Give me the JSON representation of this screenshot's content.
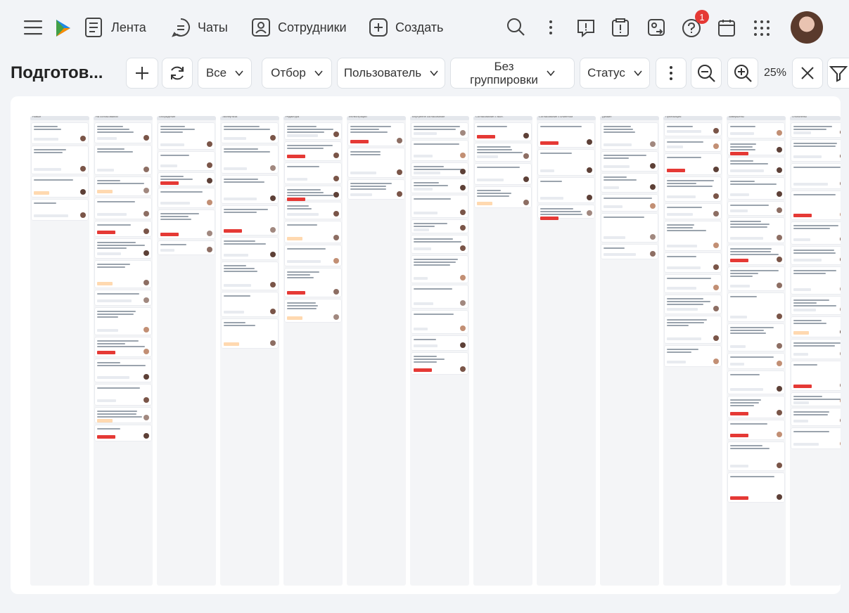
{
  "topbar": {
    "feed_label": "Лента",
    "chats_label": "Чаты",
    "employees_label": "Сотрудники",
    "create_label": "Создать",
    "notification_count": "1"
  },
  "toolbar": {
    "title": "Подготов...",
    "filter_all": "Все",
    "filter_selection": "Отбор",
    "filter_user": "Пользователь",
    "grouping_line1": "Без",
    "grouping_line2": "группировки",
    "filter_status": "Статус",
    "zoom_level": "25%"
  },
  "board": {
    "columns": [
      {
        "title": "Новые"
      },
      {
        "title": "На согласовании"
      },
      {
        "title": "Обсуждение"
      },
      {
        "title": "Экспертиза"
      },
      {
        "title": "Редактура"
      },
      {
        "title": "Иллюстрации"
      },
      {
        "title": "Внутренне согласование"
      },
      {
        "title": "Согласование с эксп."
      },
      {
        "title": "Согласование с клиентом"
      },
      {
        "title": "Дизайн"
      },
      {
        "title": "Публикация"
      },
      {
        "title": "Завершены"
      },
      {
        "title": "Отклонены"
      }
    ]
  },
  "colors": {
    "accent": "#e53935",
    "background": "#f2f4f7"
  }
}
